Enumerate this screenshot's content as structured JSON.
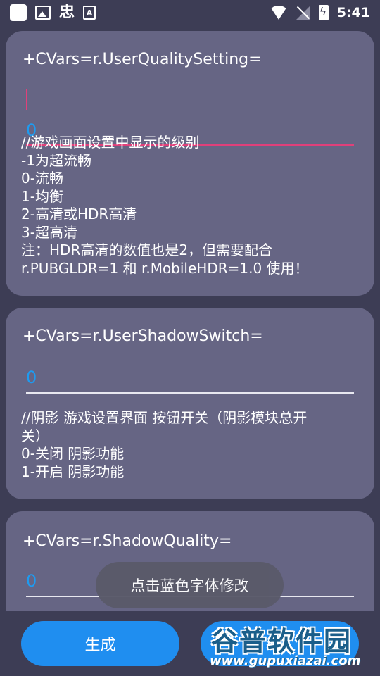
{
  "status_bar": {
    "time": "5:41",
    "glyph": "忠",
    "letter": "A",
    "icons": [
      "app-square-icon",
      "image-icon",
      "chinese-char-icon",
      "text-a-icon",
      "wifi-icon",
      "no-signal-icon",
      "battery-charging-icon"
    ]
  },
  "cards": [
    {
      "label": "+CVars=r.UserQualitySetting=",
      "value": "0",
      "focused": true,
      "description": [
        "//游戏画面设置中显示的级别",
        "-1为超流畅",
        "0-流畅",
        "1-均衡",
        "2-高清或HDR高清",
        "3-超高清",
        "注：HDR高清的数值也是2，但需要配合",
        "r.PUBGLDR=1 和 r.MobileHDR=1.0 使用！"
      ]
    },
    {
      "label": "+CVars=r.UserShadowSwitch=",
      "value": "0",
      "focused": false,
      "description": [
        "//阴影 游戏设置界面 按钮开关（阴影模块总开",
        "关）",
        "0-关闭 阴影功能",
        "1-开启 阴影功能"
      ]
    },
    {
      "label": "+CVars=r.ShadowQuality=",
      "value": "0",
      "focused": false,
      "description": []
    }
  ],
  "toast": {
    "text": "点击蓝色字体修改"
  },
  "buttons": {
    "generate_label": "生成",
    "second_label": ""
  },
  "watermark": {
    "title": "谷普软件园",
    "url": "www.gupuxiazai.com"
  },
  "colors": {
    "background": "#3d3d55",
    "card": "#666584",
    "accent_blue": "#1f8ef0",
    "value_blue": "#1e9bf0",
    "focus_pink": "#e0407a"
  }
}
